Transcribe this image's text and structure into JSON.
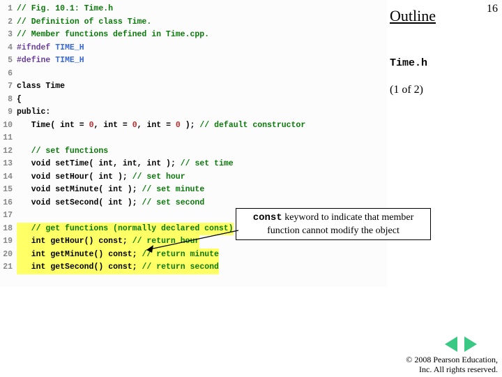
{
  "side": {
    "outline": "Outline",
    "page_num": "16",
    "file": "Time.h",
    "page_of": "(1 of 2)"
  },
  "callout": {
    "kw": "const",
    "rest": " keyword to indicate that member function cannot modify the object"
  },
  "nav": {
    "prev": "previous-slide",
    "next": "next-slide"
  },
  "copyright": {
    "l1": "© 2008 Pearson Education,",
    "l2": "Inc.  All rights reserved."
  },
  "code": [
    {
      "n": "1",
      "t": [
        [
          "comment",
          "// Fig. 10.1: Time.h"
        ]
      ]
    },
    {
      "n": "2",
      "t": [
        [
          "comment",
          "// Definition of class Time."
        ]
      ]
    },
    {
      "n": "3",
      "t": [
        [
          "comment",
          "// Member functions defined in Time.cpp."
        ]
      ]
    },
    {
      "n": "4",
      "t": [
        [
          "pp",
          "#ifndef"
        ],
        [
          "plain",
          " "
        ],
        [
          "macro",
          "TIME_H"
        ]
      ]
    },
    {
      "n": "5",
      "t": [
        [
          "pp",
          "#define"
        ],
        [
          "plain",
          " "
        ],
        [
          "macro",
          "TIME_H"
        ]
      ]
    },
    {
      "n": "6",
      "t": []
    },
    {
      "n": "7",
      "t": [
        [
          "kw",
          "class"
        ],
        [
          "plain",
          " "
        ],
        [
          "id",
          "Time"
        ]
      ]
    },
    {
      "n": "8",
      "t": [
        [
          "punc",
          "{"
        ]
      ]
    },
    {
      "n": "9",
      "t": [
        [
          "kw",
          "public"
        ],
        [
          "punc",
          ":"
        ]
      ]
    },
    {
      "n": "10",
      "t": [
        [
          "plain",
          "   "
        ],
        [
          "id",
          "Time"
        ],
        [
          "punc",
          "( "
        ],
        [
          "type",
          "int"
        ],
        [
          "punc",
          " = "
        ],
        [
          "num",
          "0"
        ],
        [
          "punc",
          ", "
        ],
        [
          "type",
          "int"
        ],
        [
          "punc",
          " = "
        ],
        [
          "num",
          "0"
        ],
        [
          "punc",
          ", "
        ],
        [
          "type",
          "int"
        ],
        [
          "punc",
          " = "
        ],
        [
          "num",
          "0"
        ],
        [
          "punc",
          " ); "
        ],
        [
          "comment",
          "// default constructor"
        ]
      ]
    },
    {
      "n": "11",
      "t": []
    },
    {
      "n": "12",
      "t": [
        [
          "plain",
          "   "
        ],
        [
          "comment",
          "// set functions"
        ]
      ]
    },
    {
      "n": "13",
      "t": [
        [
          "plain",
          "   "
        ],
        [
          "type",
          "void"
        ],
        [
          "plain",
          " "
        ],
        [
          "id",
          "setTime"
        ],
        [
          "punc",
          "( "
        ],
        [
          "type",
          "int"
        ],
        [
          "punc",
          ", "
        ],
        [
          "type",
          "int"
        ],
        [
          "punc",
          ", "
        ],
        [
          "type",
          "int"
        ],
        [
          "punc",
          " ); "
        ],
        [
          "comment",
          "// set time"
        ]
      ]
    },
    {
      "n": "14",
      "t": [
        [
          "plain",
          "   "
        ],
        [
          "type",
          "void"
        ],
        [
          "plain",
          " "
        ],
        [
          "id",
          "setHour"
        ],
        [
          "punc",
          "( "
        ],
        [
          "type",
          "int"
        ],
        [
          "punc",
          " ); "
        ],
        [
          "comment",
          "// set hour"
        ]
      ]
    },
    {
      "n": "15",
      "t": [
        [
          "plain",
          "   "
        ],
        [
          "type",
          "void"
        ],
        [
          "plain",
          " "
        ],
        [
          "id",
          "setMinute"
        ],
        [
          "punc",
          "( "
        ],
        [
          "type",
          "int"
        ],
        [
          "punc",
          " ); "
        ],
        [
          "comment",
          "// set minute"
        ]
      ]
    },
    {
      "n": "16",
      "t": [
        [
          "plain",
          "   "
        ],
        [
          "type",
          "void"
        ],
        [
          "plain",
          " "
        ],
        [
          "id",
          "setSecond"
        ],
        [
          "punc",
          "( "
        ],
        [
          "type",
          "int"
        ],
        [
          "punc",
          " ); "
        ],
        [
          "comment",
          "// set second"
        ]
      ]
    },
    {
      "n": "17",
      "t": []
    },
    {
      "n": "18",
      "hl": true,
      "t": [
        [
          "plain",
          "   "
        ],
        [
          "comment",
          "// get functions (normally declared const)"
        ]
      ]
    },
    {
      "n": "19",
      "hl": true,
      "t": [
        [
          "plain",
          "   "
        ],
        [
          "type",
          "int"
        ],
        [
          "plain",
          " "
        ],
        [
          "id",
          "getHour"
        ],
        [
          "punc",
          "() "
        ],
        [
          "kw",
          "const"
        ],
        [
          "punc",
          "; "
        ],
        [
          "comment",
          "// return hour"
        ]
      ]
    },
    {
      "n": "20",
      "hl": true,
      "t": [
        [
          "plain",
          "   "
        ],
        [
          "type",
          "int"
        ],
        [
          "plain",
          " "
        ],
        [
          "id",
          "getMinute"
        ],
        [
          "punc",
          "() "
        ],
        [
          "kw",
          "const"
        ],
        [
          "punc",
          "; "
        ],
        [
          "comment",
          "// return minute"
        ]
      ]
    },
    {
      "n": "21",
      "hl": true,
      "t": [
        [
          "plain",
          "   "
        ],
        [
          "type",
          "int"
        ],
        [
          "plain",
          " "
        ],
        [
          "id",
          "getSecond"
        ],
        [
          "punc",
          "() "
        ],
        [
          "kw",
          "const"
        ],
        [
          "punc",
          "; "
        ],
        [
          "comment",
          "// return second"
        ]
      ]
    }
  ]
}
